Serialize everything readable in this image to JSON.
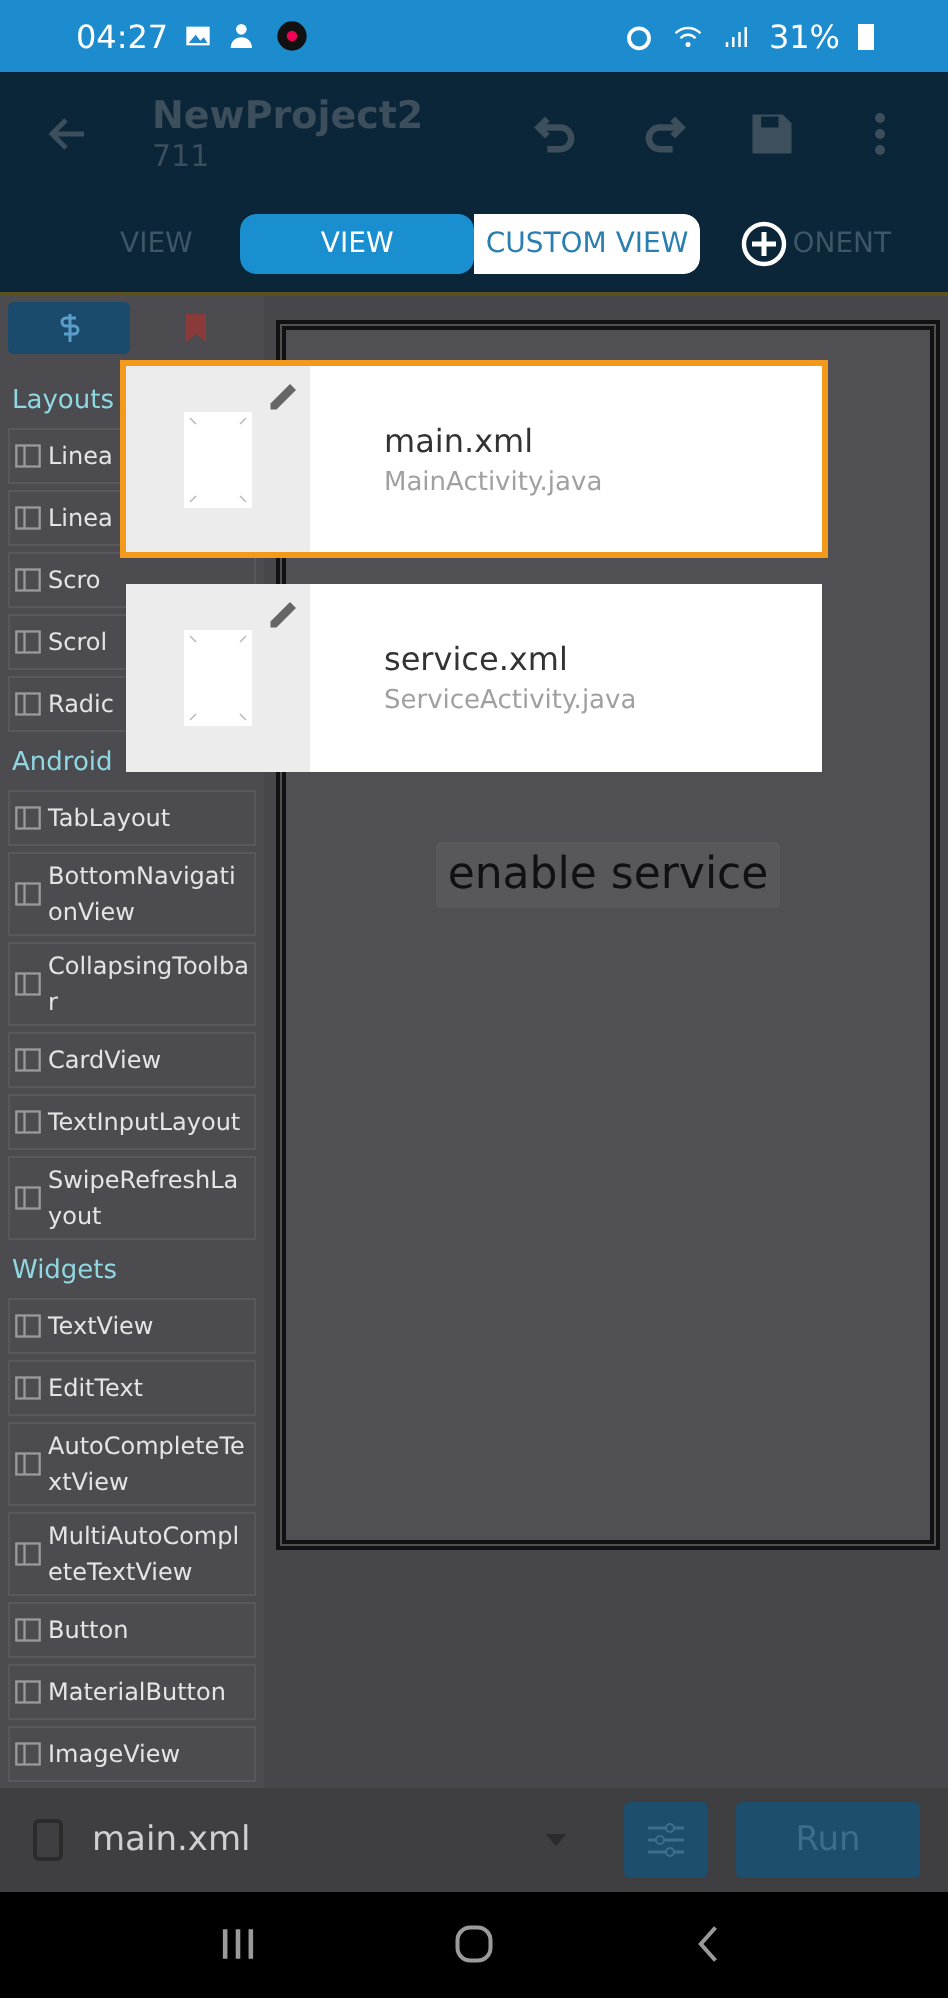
{
  "status_bar": {
    "time": "04:27",
    "battery": "31%"
  },
  "app_bar": {
    "title": "NewProject2",
    "subtitle": "711"
  },
  "tabs": [
    {
      "label": "VIEW"
    },
    {
      "label": "ONENT"
    }
  ],
  "view_toggle": [
    {
      "label": "VIEW",
      "selected": true
    },
    {
      "label": "CUSTOM VIEW",
      "selected": false
    }
  ],
  "palette": [
    {
      "title": "Layouts",
      "items": [
        {
          "label": "Linea"
        },
        {
          "label": "Linea"
        },
        {
          "label": "Scro"
        },
        {
          "label": "Scrol"
        },
        {
          "label": "Radic"
        }
      ]
    },
    {
      "title": "Android",
      "items": [
        {
          "label": "TabLayout"
        },
        {
          "label": "BottomNavigationView"
        },
        {
          "label": "CollapsingToolbar"
        },
        {
          "label": "CardView"
        },
        {
          "label": "TextInputLayout"
        },
        {
          "label": "SwipeRefreshLayout"
        }
      ]
    },
    {
      "title": "Widgets",
      "items": [
        {
          "label": "TextView"
        },
        {
          "label": "EditText"
        },
        {
          "label": "AutoCompleteTextView"
        },
        {
          "label": "MultiAutoCompleteTextView"
        },
        {
          "label": "Button"
        },
        {
          "label": "MaterialButton"
        },
        {
          "label": "ImageView"
        }
      ]
    }
  ],
  "canvas": {
    "button": "enable service"
  },
  "layout_picker": [
    {
      "file": "main.xml",
      "activity": "MainActivity.java",
      "selected": true
    },
    {
      "file": "service.xml",
      "activity": "ServiceActivity.java",
      "selected": false
    }
  ],
  "bottom_bar": {
    "file": "main.xml",
    "run": "Run"
  }
}
